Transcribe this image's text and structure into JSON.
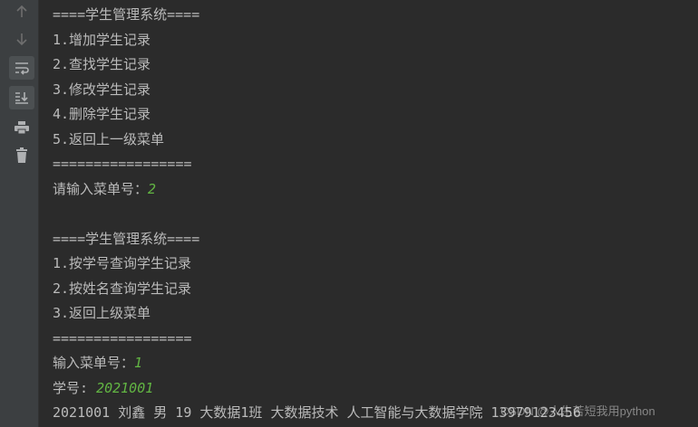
{
  "gutter": {
    "icons": [
      "arrow-up-icon",
      "arrow-down-icon",
      "soft-wrap-icon",
      "scroll-to-end-icon",
      "print-icon",
      "trash-icon"
    ]
  },
  "console": {
    "lines": [
      "====学生管理系统====",
      "1.增加学生记录",
      "2.查找学生记录",
      "3.修改学生记录",
      "4.删除学生记录",
      "5.返回上一级菜单",
      "=================",
      "请输入菜单号：",
      "",
      "====学生管理系统====",
      "1.按学号查询学生记录",
      "2.按姓名查询学生记录",
      "3.返回上级菜单",
      "=================",
      "输入菜单号：",
      "学号: ",
      "2021001 刘鑫 男 19 大数据1班 大数据技术 人工智能与大数据学院 13979123456"
    ],
    "inputs": {
      "menu_choice_1": "2",
      "menu_choice_2": "1",
      "student_id": "2021001"
    }
  },
  "colors": {
    "background": "#2b2b2b",
    "text": "#bbbbbb",
    "user_input": "#62b543",
    "gutter": "#3c3f41"
  },
  "watermark": "CSDN @人生苦短我用python"
}
